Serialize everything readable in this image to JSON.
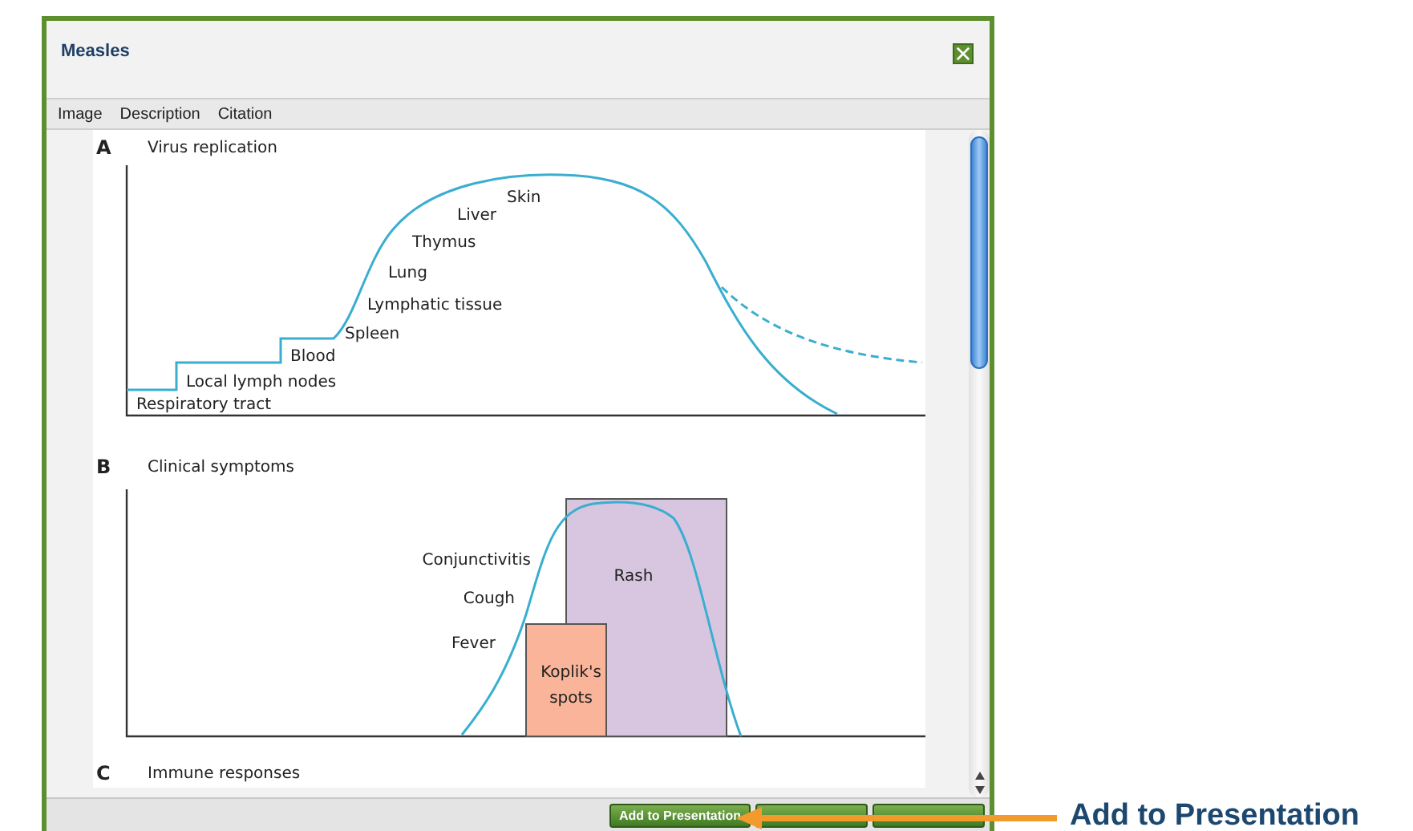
{
  "window": {
    "title": "Measles"
  },
  "tabs": [
    {
      "label": "Image"
    },
    {
      "label": "Description"
    },
    {
      "label": "Citation"
    }
  ],
  "figure": {
    "panels": [
      {
        "letter": "A",
        "title": "Virus replication",
        "labels": [
          "Skin",
          "Liver",
          "Thymus",
          "Lung",
          "Lymphatic tissue",
          "Spleen",
          "Blood",
          "Local lymph nodes",
          "Respiratory tract"
        ]
      },
      {
        "letter": "B",
        "title": "Clinical symptoms",
        "labels": [
          "Conjunctivitis",
          "Cough",
          "Fever"
        ],
        "boxes": [
          {
            "label": "Rash",
            "color": "#d8c6e0"
          },
          {
            "label": "Koplik's spots",
            "color": "#f9b499"
          }
        ]
      },
      {
        "letter": "C",
        "title": "Immune responses"
      }
    ]
  },
  "buttons": [
    {
      "kind": "labeled",
      "label": "Add to Presentation"
    },
    {
      "kind": "covered"
    },
    {
      "kind": "covered"
    }
  ],
  "callout": {
    "label": "Add to Presentation"
  }
}
